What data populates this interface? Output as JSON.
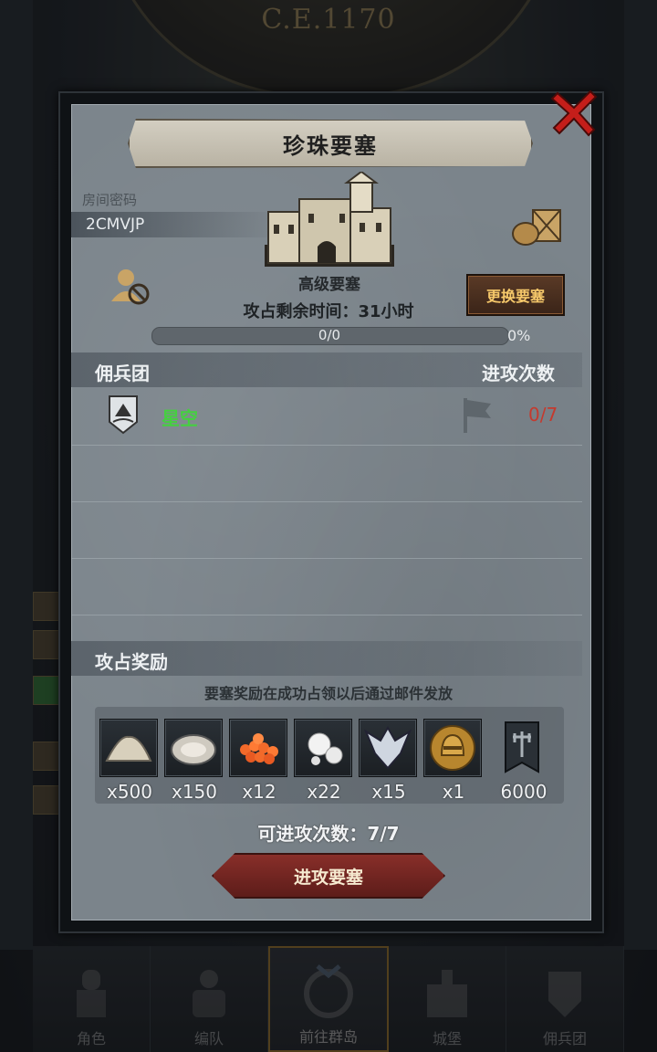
{
  "background": {
    "year": "C.E.1170"
  },
  "bottom_nav": [
    {
      "label": "角色",
      "icon": "knight-icon",
      "active": false
    },
    {
      "label": "编队",
      "icon": "team-icon",
      "active": false
    },
    {
      "label": "前往群岛",
      "icon": "compass-icon",
      "active": true
    },
    {
      "label": "城堡",
      "icon": "castle-icon",
      "active": false
    },
    {
      "label": "佣兵团",
      "icon": "mercenary-icon",
      "active": false
    }
  ],
  "dialog": {
    "title": "珍珠要塞",
    "room_label": "房间密码",
    "room_code": "2CMVJP",
    "fortress_level": "高级要塞",
    "change_button": "更换要塞",
    "remaining_time": "攻占剩余时间：31小时",
    "progress": {
      "text": "0/0",
      "percent_text": "0%",
      "fraction": 0
    },
    "header_left": "佣兵团",
    "header_right": "进攻次数",
    "mercenaries": [
      {
        "name": "星空",
        "attacks": "0/7"
      }
    ],
    "reward_title": "攻占奖励",
    "reward_note": "要塞奖励在成功占领以后通过邮件发放",
    "rewards": [
      {
        "icon": "sand-icon",
        "count": "x500"
      },
      {
        "icon": "oyster-icon",
        "count": "x150"
      },
      {
        "icon": "roe-icon",
        "count": "x12"
      },
      {
        "icon": "pearl-icon",
        "count": "x22"
      },
      {
        "icon": "emblem-icon",
        "count": "x15"
      },
      {
        "icon": "knight-helmet-icon",
        "count": "x1"
      },
      {
        "icon": "guild-banner-icon",
        "count": "6000"
      }
    ],
    "can_attack": "可进攻次数：7/7",
    "attack_button": "进攻要塞"
  },
  "colors": {
    "accent_gold": "#f6c86a",
    "merc_green": "#45d040",
    "count_red": "#c43a2e",
    "button_red": "#8a2f2a"
  }
}
